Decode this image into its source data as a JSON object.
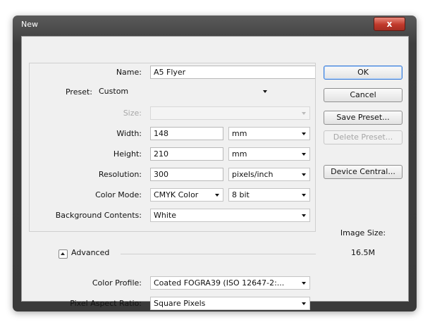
{
  "window": {
    "title": "New",
    "close_label": "x"
  },
  "form": {
    "name_label": "Name:",
    "name_value": "A5 Flyer",
    "preset_label": "Preset:",
    "preset_value": "Custom",
    "size_label": "Size:",
    "size_value": "",
    "width_label": "Width:",
    "width_value": "148",
    "width_unit": "mm",
    "height_label": "Height:",
    "height_value": "210",
    "height_unit": "mm",
    "resolution_label": "Resolution:",
    "resolution_value": "300",
    "resolution_unit": "pixels/inch",
    "color_mode_label": "Color Mode:",
    "color_mode_value": "CMYK Color",
    "bit_depth_value": "8 bit",
    "background_label": "Background Contents:",
    "background_value": "White",
    "advanced_label": "Advanced",
    "color_profile_label": "Color Profile:",
    "color_profile_value": "Coated FOGRA39 (ISO 12647-2:...",
    "pixel_aspect_label": "Pixel Aspect Ratio:",
    "pixel_aspect_value": "Square Pixels"
  },
  "buttons": {
    "ok": "OK",
    "cancel": "Cancel",
    "save_preset": "Save Preset...",
    "delete_preset": "Delete Preset...",
    "device_central": "Device Central..."
  },
  "image_size": {
    "label": "Image Size:",
    "value": "16.5M"
  },
  "colors": {
    "frame": "#3e3e3e",
    "client": "#f0f0f0",
    "close": "#c0392b",
    "ok_border": "#3a7bd5"
  }
}
